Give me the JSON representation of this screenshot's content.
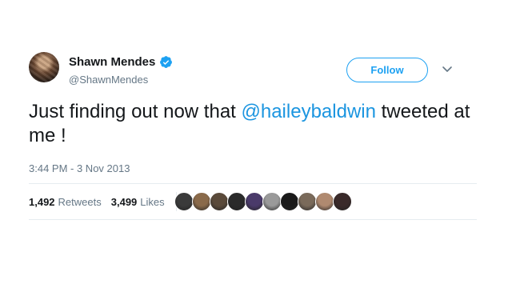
{
  "tweet": {
    "author": {
      "display_name": "Shawn Mendes",
      "handle": "@ShawnMendes",
      "verified": true,
      "avatar_icon": "profile-photo"
    },
    "follow_label": "Follow",
    "text_prefix": "Just finding out now that ",
    "mention": "@haileybaldwin",
    "text_suffix": " tweeted at me !",
    "timestamp": "3:44 PM - 3 Nov 2013",
    "stats": {
      "retweets_count": "1,492",
      "retweets_label": "Retweets",
      "likes_count": "3,499",
      "likes_label": "Likes"
    },
    "likers": [
      {
        "name": "liker-1",
        "color": "#3a3a3a"
      },
      {
        "name": "liker-2",
        "color": "#8a6a4a"
      },
      {
        "name": "liker-3",
        "color": "#5a4a3a"
      },
      {
        "name": "liker-4",
        "color": "#2a2a2a"
      },
      {
        "name": "liker-5",
        "color": "#4a3a6a"
      },
      {
        "name": "liker-6",
        "color": "#9a9a9a"
      },
      {
        "name": "liker-7",
        "color": "#1a1a1a"
      },
      {
        "name": "liker-8",
        "color": "#7a6a5a"
      },
      {
        "name": "liker-9",
        "color": "#b08a70"
      },
      {
        "name": "liker-10",
        "color": "#3a2a2a"
      }
    ]
  },
  "colors": {
    "accent": "#1da1f2",
    "mention": "#1b95e0",
    "secondary_text": "#657786",
    "primary_text": "#14171a",
    "divider": "#e6ecf0"
  }
}
